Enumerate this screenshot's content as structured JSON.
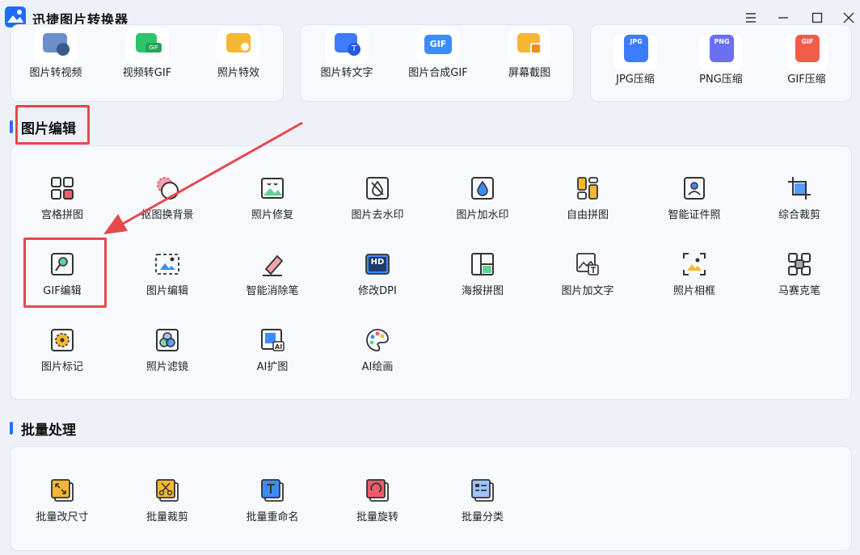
{
  "app": {
    "title": "迅捷图片转换器"
  },
  "window_controls": {
    "menu": "menu-icon",
    "minimize": "minimize-icon",
    "maximize": "maximize-icon",
    "close": "close-icon"
  },
  "top_cards": {
    "card1": [
      "图片转视频",
      "视频转GIF",
      "照片特效"
    ],
    "card2": [
      "图片转文字",
      "图片合成GIF",
      "屏幕截图"
    ],
    "card3": [
      "JPG压缩",
      "PNG压缩",
      "GIF压缩"
    ],
    "badges": {
      "gif": "GIF",
      "jpg": "JPG",
      "png": "PNG",
      "gif2": "GIF"
    }
  },
  "sections": {
    "edit": {
      "title": "图片编辑",
      "items": [
        "宫格拼图",
        "抠图换背景",
        "照片修复",
        "图片去水印",
        "图片加水印",
        "自由拼图",
        "智能证件照",
        "综合裁剪",
        "GIF编辑",
        "图片编辑",
        "智能消除笔",
        "修改DPI",
        "海报拼图",
        "图片加文字",
        "照片相框",
        "马赛克笔",
        "图片标记",
        "照片滤镜",
        "AI扩图",
        "AI绘画"
      ],
      "hd_badge": "HD"
    },
    "batch": {
      "title": "批量处理",
      "items": [
        "批量改尺寸",
        "批量裁剪",
        "批量重命名",
        "批量旋转",
        "批量分类"
      ]
    }
  },
  "colors": {
    "accent": "#2c6bff",
    "highlight": "#e5484d",
    "icon_blue": "#3d7bff",
    "icon_orange": "#f5a623"
  }
}
